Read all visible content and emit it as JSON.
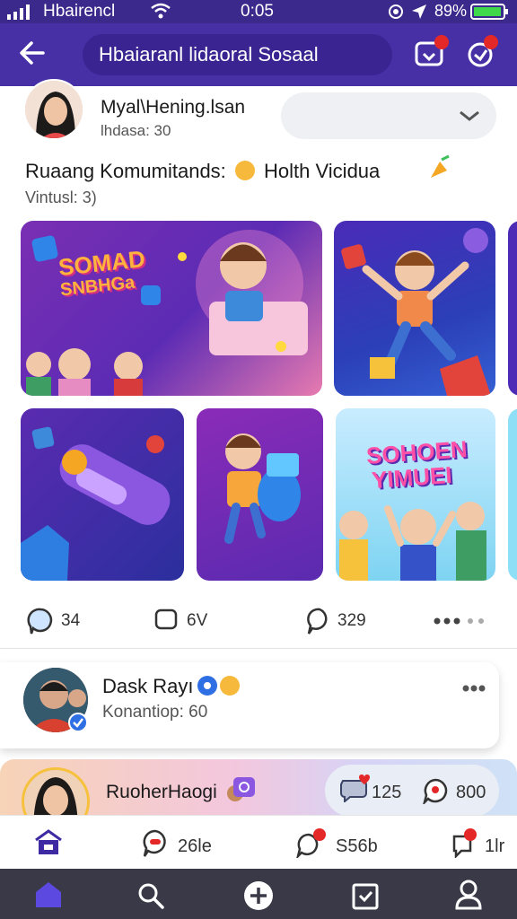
{
  "status_bar": {
    "carrier": "Hbairencl",
    "time": "0:05",
    "battery": "89%"
  },
  "header": {
    "search_text": "Hbaiaranl lidaoral Sosaal"
  },
  "post": {
    "username": "Myal\\Hening.lsan",
    "subtitle": "lhdasa: 30",
    "title": "Ruaang Komumitands:",
    "title_suffix": "Holth Vicidua",
    "caption": "Vintusl: 3)",
    "card1_text_line1": "SOMAD",
    "card1_text_line2": "SNBHGa",
    "card3_text_line1": "SOHOEN",
    "card3_text_line2": "YIMUEI",
    "likes": "34",
    "comments": "6V",
    "shares": "329"
  },
  "contact_card": {
    "name": "Dask Rayı",
    "subtitle": "Konantiop: 60"
  },
  "next_post": {
    "username": "RuoherHaogi",
    "reactions": "125",
    "comments": "800"
  },
  "tabs": {
    "messages": "26le",
    "alerts": "S56b",
    "notifications": "1lr"
  },
  "colors": {
    "header_bg": "#4730a6",
    "nav_bg": "#3a3947",
    "accent": "#3e2ba3",
    "badge": "#e42828"
  }
}
